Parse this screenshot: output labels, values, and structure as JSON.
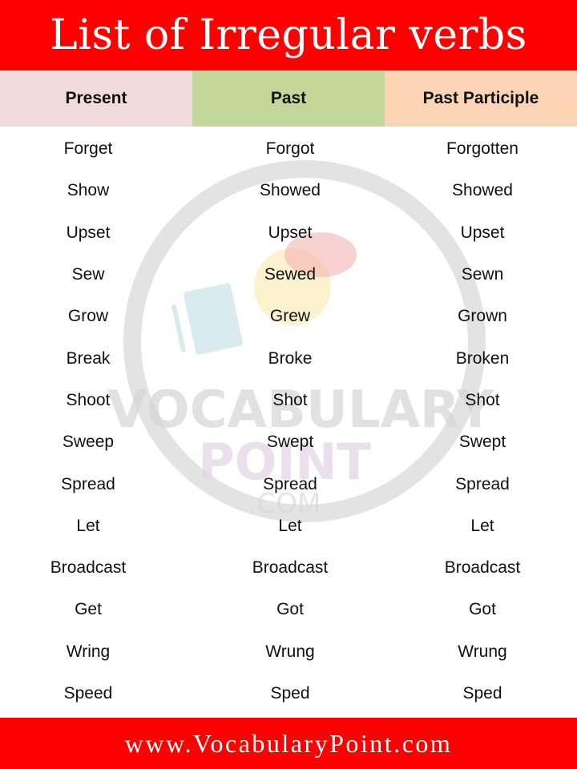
{
  "title": "List of Irregular verbs",
  "colors": {
    "banner": "#fe0000",
    "present_header": "#f2dcdb",
    "past_header": "#c4d79b",
    "past_participle_header": "#fbd5b5"
  },
  "table": {
    "headers": [
      "Present",
      "Past",
      "Past Participle"
    ],
    "rows": [
      [
        "Forget",
        "Forgot",
        "Forgotten"
      ],
      [
        "Show",
        "Showed",
        "Showed"
      ],
      [
        "Upset",
        "Upset",
        "Upset"
      ],
      [
        "Sew",
        "Sewed",
        "Sewn"
      ],
      [
        "Grow",
        "Grew",
        "Grown"
      ],
      [
        "Break",
        "Broke",
        "Broken"
      ],
      [
        "Shoot",
        "Shot",
        "Shot"
      ],
      [
        "Sweep",
        "Swept",
        "Swept"
      ],
      [
        "Spread",
        "Spread",
        "Spread"
      ],
      [
        "Let",
        "Let",
        "Let"
      ],
      [
        "Broadcast",
        "Broadcast",
        "Broadcast"
      ],
      [
        "Get",
        "Got",
        "Got"
      ],
      [
        "Wring",
        "Wrung",
        "Wrung"
      ],
      [
        "Speed",
        "Sped",
        "Sped"
      ]
    ]
  },
  "watermark": {
    "line1": "VOCABULARY",
    "line2": "POINT",
    "line3": ".COM"
  },
  "footer": "www.VocabularyPoint.com"
}
